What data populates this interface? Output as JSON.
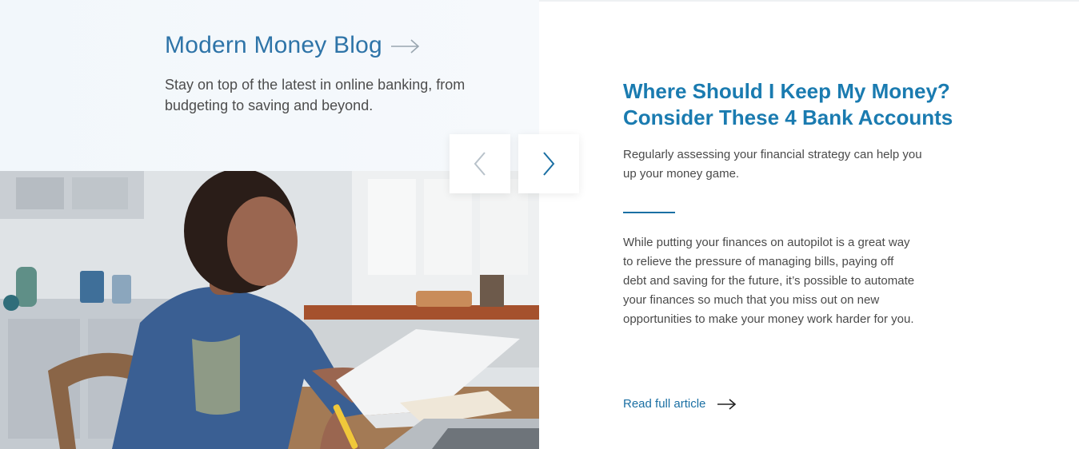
{
  "blog": {
    "title": "Modern Money Blog",
    "subtitle": "Stay on top of the latest in online banking, from budgeting to saving and beyond."
  },
  "carousel": {
    "prev_icon": "chevron-left-icon",
    "next_icon": "chevron-right-icon"
  },
  "article": {
    "title": "Where Should I Keep My Money? Consider These 4 Bank Accounts",
    "lead": "Regularly assessing your financial strategy can help you up your money game.",
    "body": "While putting your finances on autopilot is a great way to relieve the pressure of managing bills, paying off debt and saving for the future, it’s possible to automate your finances so much that you miss out on new opportunities to make your money work harder for you.",
    "read_more": "Read full article"
  },
  "colors": {
    "accent": "#1a7bb0",
    "panel_bg": "#f4f8fb",
    "text": "#4a4a4a"
  }
}
